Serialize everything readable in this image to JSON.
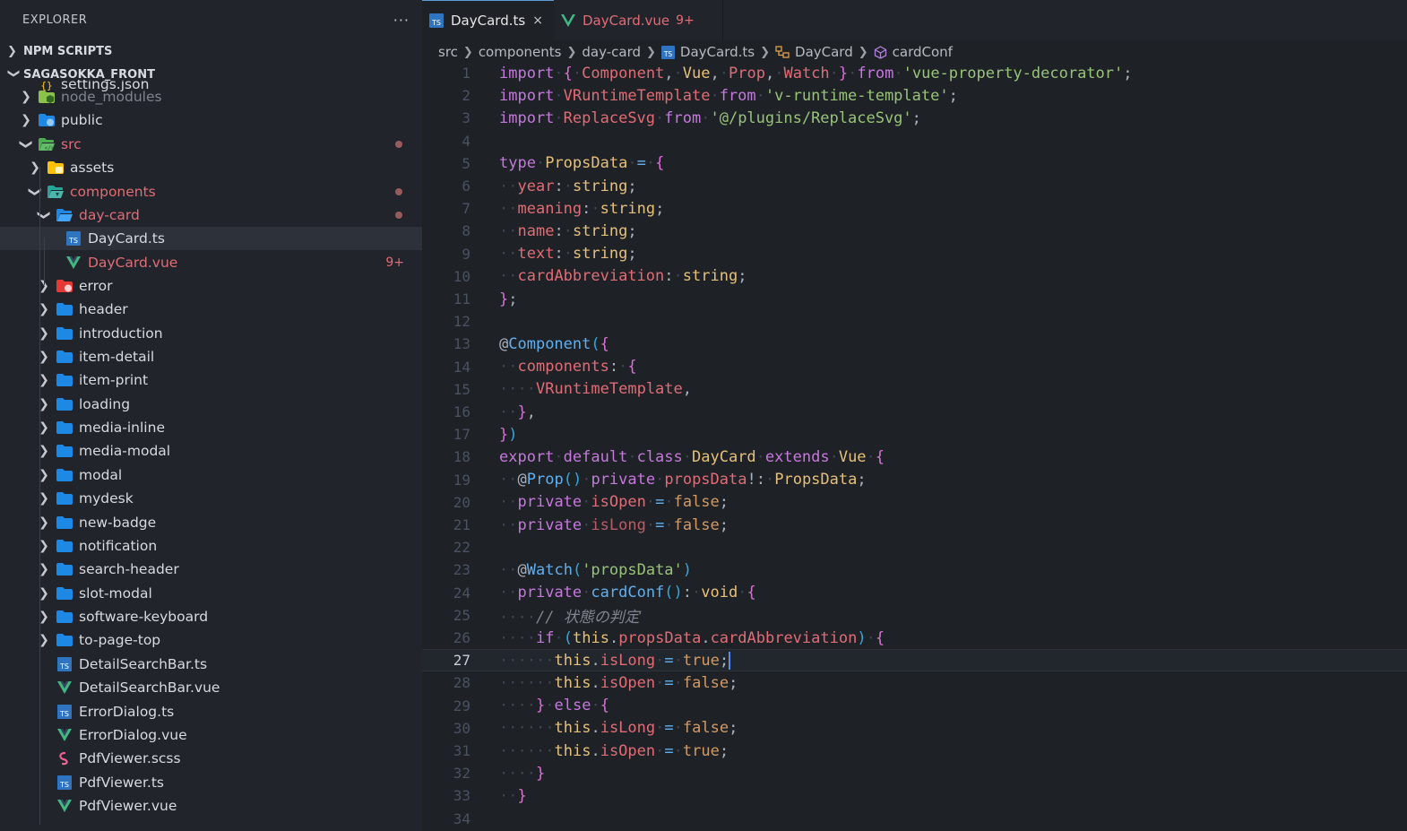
{
  "explorer": {
    "title": "EXPLORER",
    "more": "···",
    "npm_scripts": "NPM SCRIPTS",
    "project": "SAGASOKKA_FRONT",
    "items": [
      {
        "label": "settings.json",
        "kind": "json",
        "depth": 1
      },
      {
        "label": "node_modules",
        "kind": "folder-node",
        "depth": 1
      },
      {
        "label": "public",
        "kind": "folder-public",
        "depth": 1
      },
      {
        "label": "src",
        "kind": "folder-src",
        "depth": 1
      },
      {
        "label": "assets",
        "kind": "folder-assets",
        "depth": 2
      },
      {
        "label": "components",
        "kind": "folder-components",
        "depth": 2
      },
      {
        "label": "day-card",
        "kind": "folder-open",
        "depth": 3
      },
      {
        "label": "DayCard.ts",
        "kind": "ts",
        "depth": 4
      },
      {
        "label": "DayCard.vue",
        "kind": "vue",
        "depth": 4,
        "badge": "9+"
      },
      {
        "label": "error",
        "kind": "folder-error",
        "depth": 3
      },
      {
        "label": "header",
        "kind": "folder",
        "depth": 3
      },
      {
        "label": "introduction",
        "kind": "folder",
        "depth": 3
      },
      {
        "label": "item-detail",
        "kind": "folder",
        "depth": 3
      },
      {
        "label": "item-print",
        "kind": "folder",
        "depth": 3
      },
      {
        "label": "loading",
        "kind": "folder",
        "depth": 3
      },
      {
        "label": "media-inline",
        "kind": "folder",
        "depth": 3
      },
      {
        "label": "media-modal",
        "kind": "folder",
        "depth": 3
      },
      {
        "label": "modal",
        "kind": "folder",
        "depth": 3
      },
      {
        "label": "mydesk",
        "kind": "folder",
        "depth": 3
      },
      {
        "label": "new-badge",
        "kind": "folder",
        "depth": 3
      },
      {
        "label": "notification",
        "kind": "folder",
        "depth": 3
      },
      {
        "label": "search-header",
        "kind": "folder",
        "depth": 3
      },
      {
        "label": "slot-modal",
        "kind": "folder",
        "depth": 3
      },
      {
        "label": "software-keyboard",
        "kind": "folder",
        "depth": 3
      },
      {
        "label": "to-page-top",
        "kind": "folder",
        "depth": 3
      },
      {
        "label": "DetailSearchBar.ts",
        "kind": "ts",
        "depth": 3
      },
      {
        "label": "DetailSearchBar.vue",
        "kind": "vue",
        "depth": 3
      },
      {
        "label": "ErrorDialog.ts",
        "kind": "ts",
        "depth": 3
      },
      {
        "label": "ErrorDialog.vue",
        "kind": "vue",
        "depth": 3
      },
      {
        "label": "PdfViewer.scss",
        "kind": "scss",
        "depth": 3
      },
      {
        "label": "PdfViewer.ts",
        "kind": "ts",
        "depth": 3
      },
      {
        "label": "PdfViewer.vue",
        "kind": "vue",
        "depth": 3
      }
    ]
  },
  "tabs": [
    {
      "label": "DayCard.ts",
      "active": true,
      "close": "×"
    },
    {
      "label": "DayCard.vue",
      "active": false,
      "badge": "9+"
    }
  ],
  "breadcrumb": [
    "src",
    "components",
    "day-card",
    "DayCard.ts",
    "DayCard",
    "cardConf"
  ],
  "editor": {
    "current_line": 27,
    "line_numbers": [
      "1",
      "2",
      "3",
      "4",
      "5",
      "6",
      "7",
      "8",
      "9",
      "10",
      "11",
      "12",
      "13",
      "14",
      "15",
      "16",
      "17",
      "18",
      "19",
      "20",
      "21",
      "22",
      "23",
      "24",
      "25",
      "26",
      "27",
      "28",
      "29",
      "30",
      "31",
      "32",
      "33",
      "34"
    ],
    "lines": [
      "import { Component, Vue, Prop, Watch } from 'vue-property-decorator';",
      "import VRuntimeTemplate from 'v-runtime-template';",
      "import ReplaceSvg from '@/plugins/ReplaceSvg';",
      "",
      "type PropsData = {",
      "  year: string;",
      "  meaning: string;",
      "  name: string;",
      "  text: string;",
      "  cardAbbreviation: string;",
      "};",
      "",
      "@Component({",
      "  components: {",
      "    VRuntimeTemplate,",
      "  },",
      "})",
      "export default class DayCard extends Vue {",
      "  @Prop() private propsData!: PropsData;",
      "  private isOpen = false;",
      "  private isLong = false;",
      "",
      "  @Watch('propsData')",
      "  private cardConf(): void {",
      "    // 状態の判定",
      "    if (this.propsData.cardAbbreviation) {",
      "      this.isLong = true;",
      "      this.isOpen = false;",
      "    } else {",
      "      this.isLong = false;",
      "      this.isOpen = true;",
      "    }",
      "  }",
      ""
    ]
  },
  "colors": {
    "keyword": "#c678dd",
    "string": "#98c379",
    "type": "#e5c07b",
    "variable": "#e06c75",
    "function": "#61afef",
    "folder": "#1e88e5",
    "vue": "#41b883",
    "ts": "#2f74c0"
  }
}
